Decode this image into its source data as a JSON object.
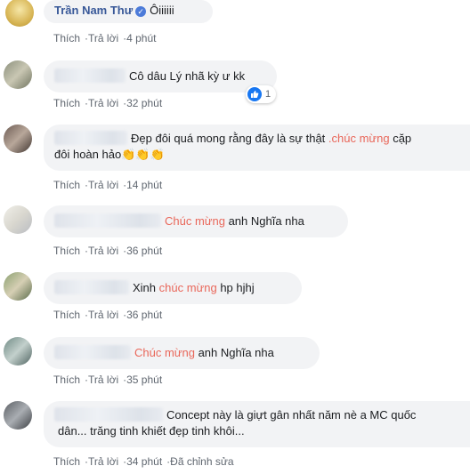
{
  "actions": {
    "like": "Thích",
    "reply": "Trả lời",
    "edited": "Đã chỉnh sửa"
  },
  "comments": [
    {
      "author": "Trần Nam Thư",
      "text": "Ôiiiiii",
      "time": "4 phút"
    },
    {
      "text": "Cô dâu Lý nhã kỳ ư kk",
      "time": "32 phút",
      "reactions": "1"
    },
    {
      "text_a": "Đẹp đôi quá mong rằng đây là sự thật ",
      "highlight": ".chúc mừng",
      "text_b": " cặp",
      "text_c": "đôi hoàn hảo",
      "claps": "👏👏👏",
      "time": "14 phút"
    },
    {
      "highlight": "Chúc mừng",
      "text": " anh Nghĩa nha",
      "time": "36 phút"
    },
    {
      "text_a": "Xinh ",
      "highlight": "chúc mừng",
      "text_b": " hp hjhj",
      "time": "36 phút"
    },
    {
      "highlight": "Chúc mừng",
      "text": " anh Nghĩa nha",
      "time": "35 phút"
    },
    {
      "text_a": "Concept này là giựt gân nhất năm nè a MC quốc",
      "text_b": "dân... trăng tinh khiết đẹp tinh khôi...",
      "time": "34 phút"
    }
  ]
}
